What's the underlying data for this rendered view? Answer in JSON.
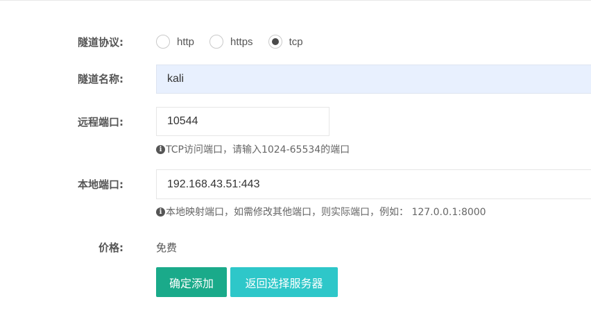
{
  "form": {
    "protocol": {
      "label": "隧道协议:",
      "options": [
        {
          "label": "http",
          "checked": false
        },
        {
          "label": "https",
          "checked": false
        },
        {
          "label": "tcp",
          "checked": true
        }
      ]
    },
    "tunnel_name": {
      "label": "隧道名称:",
      "value": "kali"
    },
    "remote_port": {
      "label": "远程端口:",
      "value": "10544",
      "hint": "TCP访问端口，请输入1024-65534的端口"
    },
    "local_port": {
      "label": "本地端口:",
      "value": "192.168.43.51:443",
      "hint": "本地映射端口，如需修改其他端口，则实际端口，例如： 127.0.0.1:8000"
    },
    "price": {
      "label": "价格:",
      "value": "免费"
    }
  },
  "buttons": {
    "confirm": "确定添加",
    "back": "返回选择服务器"
  },
  "colors": {
    "confirm_button": "#1aaa8a",
    "back_button": "#2ec7c9",
    "autofill_background": "#e8f0fe"
  },
  "icons": {
    "hint_icon": "info-circle-icon"
  }
}
